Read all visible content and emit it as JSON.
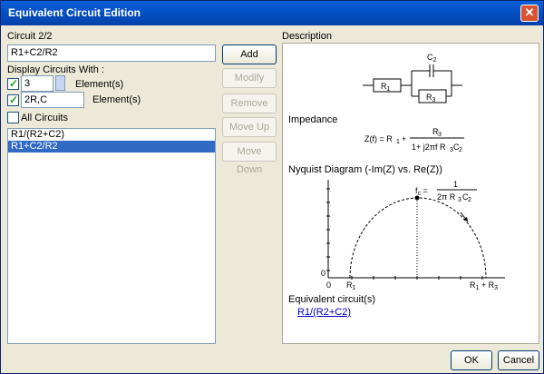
{
  "window": {
    "title": "Equivalent Circuit Edition",
    "close_glyph": "✕"
  },
  "left": {
    "circuit_label": "Circuit 2/2",
    "circuit_value": "R1+C2/R2",
    "display_label": "Display Circuits With :",
    "elements_count": "3",
    "elements_label": "Element(s)",
    "element_filter": "2R,C",
    "element_filter_label": "Element(s)",
    "all_circuits_label": "All Circuits",
    "list_items": [
      "R1/(R2+C2)",
      "R1+C2/R2"
    ]
  },
  "buttons": {
    "add": "Add",
    "modify": "Modify",
    "remove": "Remove",
    "move_up": "Move Up",
    "move_down": "Move Down",
    "ok": "OK",
    "cancel": "Cancel"
  },
  "description": {
    "label": "Description",
    "impedance_label": "Impedance",
    "nyquist_label": "Nyquist Diagram (-Im(Z) vs. Re(Z))",
    "equivalent_label": "Equivalent circuit(s)",
    "equivalent_link": "R1/(R2+C2)"
  }
}
